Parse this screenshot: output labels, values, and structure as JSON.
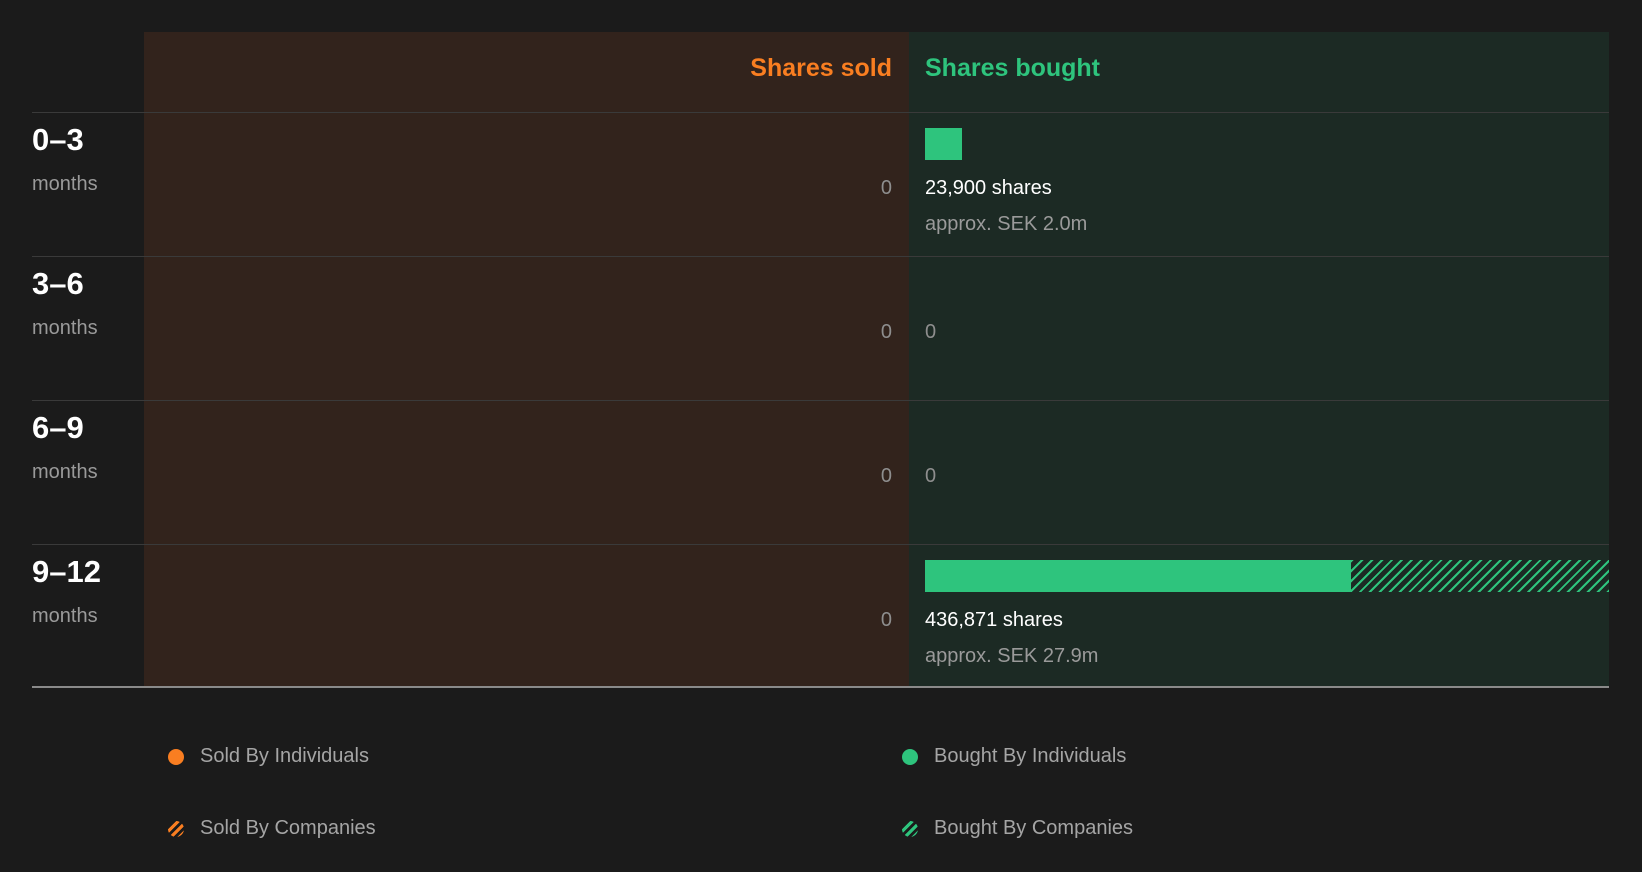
{
  "chart_data": {
    "type": "bar",
    "headers": {
      "sold": "Shares sold",
      "bought": "Shares bought"
    },
    "colors": {
      "sold": "#f97e21",
      "bought": "#2ec47d"
    },
    "max_shares": 436871,
    "rows": [
      {
        "period": "0–3",
        "unit": "months",
        "sold": "0",
        "bought_individuals": 23900,
        "bought_companies": 0,
        "bought_text": "23,900 shares",
        "bought_value": "approx. SEK 2.0m"
      },
      {
        "period": "3–6",
        "unit": "months",
        "sold": "0",
        "bought_individuals": 0,
        "bought_companies": 0,
        "bought_text": "0",
        "bought_value": ""
      },
      {
        "period": "6–9",
        "unit": "months",
        "sold": "0",
        "bought_individuals": 0,
        "bought_companies": 0,
        "bought_text": "0",
        "bought_value": ""
      },
      {
        "period": "9–12",
        "unit": "months",
        "sold": "0",
        "bought_individuals": 272000,
        "bought_companies": 164871,
        "bought_text": "436,871 shares",
        "bought_value": "approx. SEK 27.9m"
      }
    ],
    "legend": [
      {
        "label": "Sold By Individuals"
      },
      {
        "label": "Bought By Individuals"
      },
      {
        "label": "Sold By Companies"
      },
      {
        "label": "Bought By Companies"
      }
    ]
  }
}
